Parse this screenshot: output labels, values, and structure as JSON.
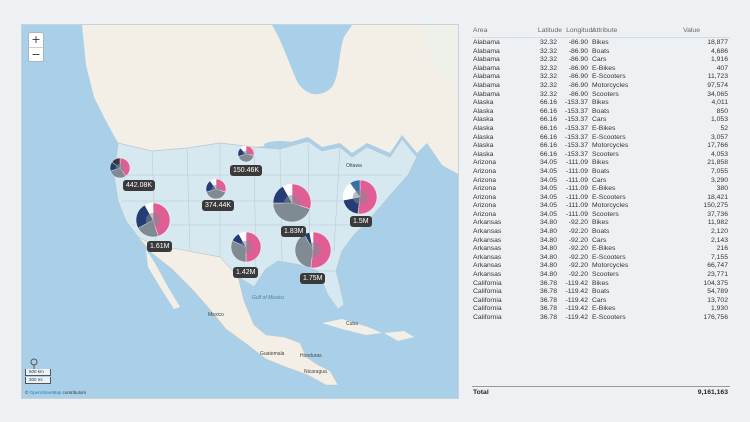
{
  "map": {
    "zoom_in": "+",
    "zoom_out": "−",
    "scale_top": "500 km",
    "scale_bottom": "300 mi",
    "attribution_prefix": "© ",
    "attribution_link": "OpenStreetMap",
    "attribution_suffix": " contributors",
    "place_labels": [
      "Ottawa",
      "Gulf of Mexico",
      "Mexico",
      "Cuba",
      "Guatemala",
      "Honduras",
      "Nicaragua"
    ],
    "colors": {
      "water": "#a9d0e8",
      "land": "#f3efe6",
      "usa_fill": "#d6e8f0",
      "state_line": "#b9c6d1",
      "slice_pink": "#e15e94",
      "slice_navy": "#243e75",
      "slice_blue": "#3b6ea5",
      "slice_grey": "#808a93",
      "slice_dark": "#36393e",
      "slice_white": "#ffffff",
      "slice_purple": "#8c3f88"
    },
    "bubbles": [
      {
        "label": "442.08K"
      },
      {
        "label": "150.46K"
      },
      {
        "label": "374.44K"
      },
      {
        "label": "1.83M"
      },
      {
        "label": "1.5M"
      },
      {
        "label": "1.61M"
      },
      {
        "label": "1.42M"
      },
      {
        "label": "1.75M"
      }
    ]
  },
  "table": {
    "headers": [
      "Area",
      "Latitude",
      "Longitude",
      "Attribute",
      "Value"
    ],
    "rows": [
      [
        "Alabama",
        "32.32",
        "-86.90",
        "Bikes",
        "18,877"
      ],
      [
        "Alabama",
        "32.32",
        "-86.90",
        "Boats",
        "4,686"
      ],
      [
        "Alabama",
        "32.32",
        "-86.90",
        "Cars",
        "1,916"
      ],
      [
        "Alabama",
        "32.32",
        "-86.90",
        "E-Bikes",
        "407"
      ],
      [
        "Alabama",
        "32.32",
        "-86.90",
        "E-Scooters",
        "11,723"
      ],
      [
        "Alabama",
        "32.32",
        "-86.90",
        "Motorcycles",
        "97,574"
      ],
      [
        "Alabama",
        "32.32",
        "-86.90",
        "Scooters",
        "34,065"
      ],
      [
        "Alaska",
        "66.16",
        "-153.37",
        "Bikes",
        "4,011"
      ],
      [
        "Alaska",
        "66.16",
        "-153.37",
        "Boats",
        "850"
      ],
      [
        "Alaska",
        "66.16",
        "-153.37",
        "Cars",
        "1,053"
      ],
      [
        "Alaska",
        "66.16",
        "-153.37",
        "E-Bikes",
        "52"
      ],
      [
        "Alaska",
        "66.16",
        "-153.37",
        "E-Scooters",
        "3,057"
      ],
      [
        "Alaska",
        "66.16",
        "-153.37",
        "Motorcycles",
        "17,766"
      ],
      [
        "Alaska",
        "66.16",
        "-153.37",
        "Scooters",
        "4,053"
      ],
      [
        "Arizona",
        "34.05",
        "-111.09",
        "Bikes",
        "21,858"
      ],
      [
        "Arizona",
        "34.05",
        "-111.09",
        "Boats",
        "7,055"
      ],
      [
        "Arizona",
        "34.05",
        "-111.09",
        "Cars",
        "3,290"
      ],
      [
        "Arizona",
        "34.05",
        "-111.09",
        "E-Bikes",
        "380"
      ],
      [
        "Arizona",
        "34.05",
        "-111.09",
        "E-Scooters",
        "18,421"
      ],
      [
        "Arizona",
        "34.05",
        "-111.09",
        "Motorcycles",
        "150,275"
      ],
      [
        "Arizona",
        "34.05",
        "-111.09",
        "Scooters",
        "37,736"
      ],
      [
        "Arkansas",
        "34.80",
        "-92.20",
        "Bikes",
        "11,982"
      ],
      [
        "Arkansas",
        "34.80",
        "-92.20",
        "Boats",
        "2,120"
      ],
      [
        "Arkansas",
        "34.80",
        "-92.20",
        "Cars",
        "2,143"
      ],
      [
        "Arkansas",
        "34.80",
        "-92.20",
        "E-Bikes",
        "216"
      ],
      [
        "Arkansas",
        "34.80",
        "-92.20",
        "E-Scooters",
        "7,155"
      ],
      [
        "Arkansas",
        "34.80",
        "-92.20",
        "Motorcycles",
        "66,747"
      ],
      [
        "Arkansas",
        "34.80",
        "-92.20",
        "Scooters",
        "23,771"
      ],
      [
        "California",
        "36.78",
        "-119.42",
        "Bikes",
        "104,375"
      ],
      [
        "California",
        "36.78",
        "-119.42",
        "Boats",
        "54,789"
      ],
      [
        "California",
        "36.78",
        "-119.42",
        "Cars",
        "13,702"
      ],
      [
        "California",
        "36.78",
        "-119.42",
        "E-Bikes",
        "1,930"
      ],
      [
        "California",
        "36.78",
        "-119.42",
        "E-Scooters",
        "176,756"
      ]
    ],
    "total_label": "Total",
    "total_value": "9,161,163"
  }
}
